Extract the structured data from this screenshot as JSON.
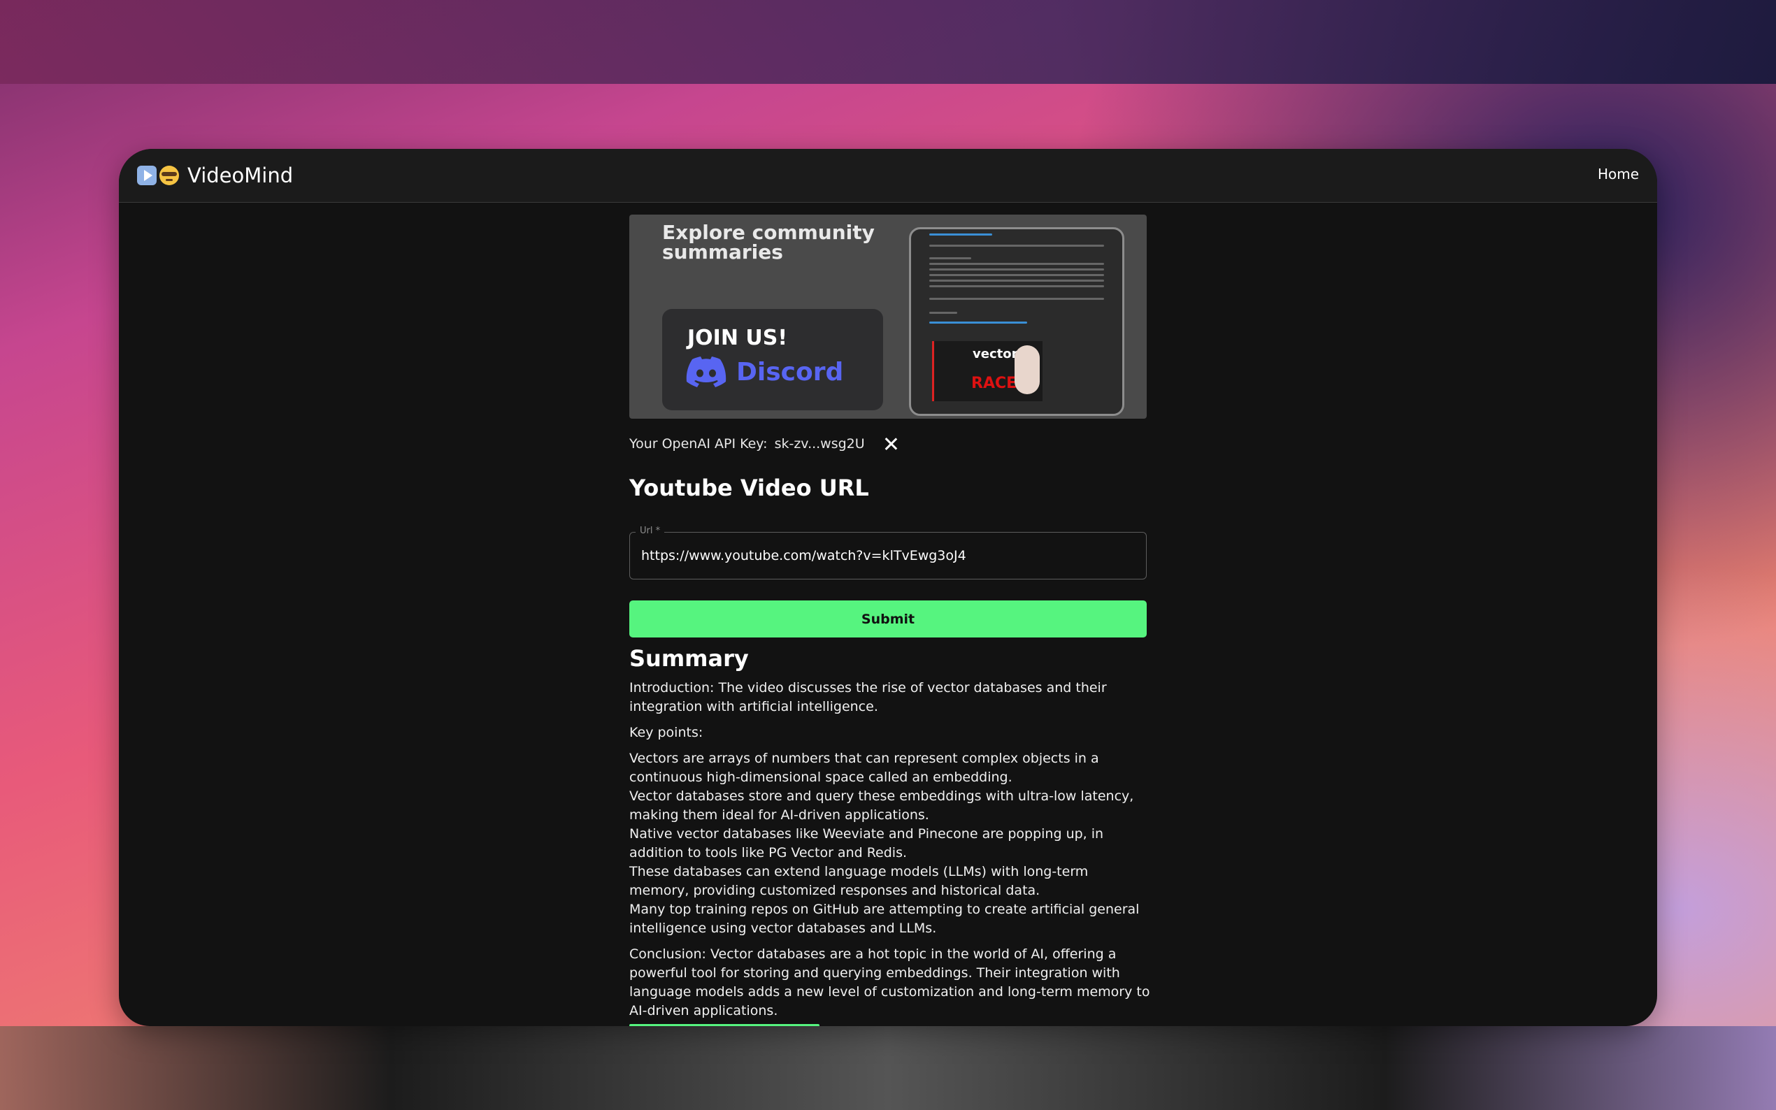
{
  "app": {
    "name": "VideoMind"
  },
  "nav": {
    "home_label": "Home"
  },
  "banner": {
    "title": "Explore community summaries",
    "join_label": "JOIN US!",
    "discord_label": "Discord",
    "thumb_text_1": "vector",
    "thumb_text_2": "RACE"
  },
  "api_key": {
    "label": "Your OpenAI API Key:",
    "value": "sk-zv...wsg2U"
  },
  "form": {
    "title": "Youtube Video URL",
    "url_label": "Url *",
    "url_value": "https://www.youtube.com/watch?v=klTvEwg3oJ4",
    "submit_label": "Submit"
  },
  "summary": {
    "title": "Summary",
    "intro": "Introduction: The video discusses the rise of vector databases and their integration with artificial intelligence.",
    "key_points_label": "Key points:",
    "key_points": [
      "Vectors are arrays of numbers that can represent complex objects in a continuous high-dimensional space called an embedding.",
      "Vector databases store and query these embeddings with ultra-low latency, making them ideal for AI-driven applications.",
      "Native vector databases like Weeviate and Pinecone are popping up, in addition to tools like PG Vector and Redis.",
      "These databases can extend language models (LLMs) with long-term memory, providing customized responses and historical data.",
      "Many top training repos on GitHub are attempting to create artificial general intelligence using vector databases and LLMs."
    ],
    "conclusion": "Conclusion: Vector databases are a hot topic in the world of AI, offering a powerful tool for storing and querying embeddings. Their integration with language models adds a new level of customization and long-term memory to AI-driven applications."
  },
  "colors": {
    "accent": "#56f47f",
    "discord": "#5865f2",
    "window_bg": "#121212"
  }
}
